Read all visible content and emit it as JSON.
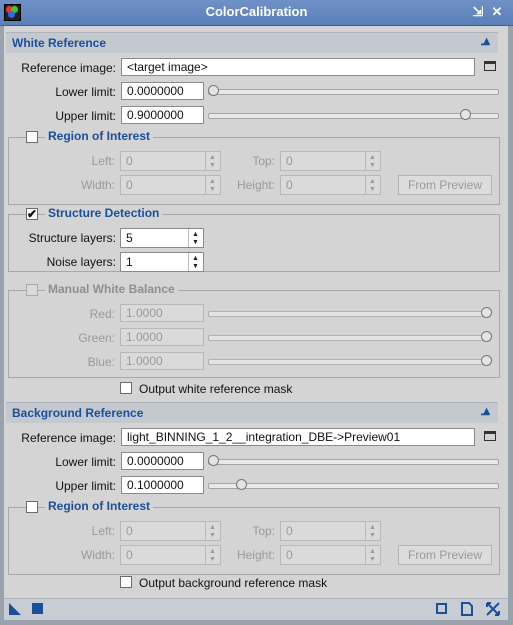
{
  "window": {
    "title": "ColorCalibration"
  },
  "white_reference": {
    "section_title": "White Reference",
    "reference_image_label": "Reference image:",
    "reference_image_value": "<target image>",
    "lower_limit_label": "Lower limit:",
    "lower_limit_value": "0.0000000",
    "lower_limit_fraction": 0.0,
    "upper_limit_label": "Upper limit:",
    "upper_limit_value": "0.9000000",
    "upper_limit_fraction": 0.9,
    "roi": {
      "title": "Region of Interest",
      "left_label": "Left:",
      "left_value": "0",
      "top_label": "Top:",
      "top_value": "0",
      "width_label": "Width:",
      "width_value": "0",
      "height_label": "Height:",
      "height_value": "0",
      "from_preview_label": "From Preview"
    },
    "structure": {
      "title": "Structure Detection",
      "checked": true,
      "layers_label": "Structure layers:",
      "layers_value": "5",
      "noise_label": "Noise layers:",
      "noise_value": "1"
    },
    "manual": {
      "title": "Manual White Balance",
      "red_label": "Red:",
      "red_value": "1.0000",
      "green_label": "Green:",
      "green_value": "1.0000",
      "blue_label": "Blue:",
      "blue_value": "1.0000"
    },
    "output_mask_label": "Output white reference mask"
  },
  "background_reference": {
    "section_title": "Background Reference",
    "reference_image_label": "Reference image:",
    "reference_image_value": "light_BINNING_1_2__integration_DBE->Preview01",
    "lower_limit_label": "Lower limit:",
    "lower_limit_value": "0.0000000",
    "lower_limit_fraction": 0.0,
    "upper_limit_label": "Upper limit:",
    "upper_limit_value": "0.1000000",
    "upper_limit_fraction": 0.1,
    "roi": {
      "title": "Region of Interest",
      "left_label": "Left:",
      "left_value": "0",
      "top_label": "Top:",
      "top_value": "0",
      "width_label": "Width:",
      "width_value": "0",
      "height_label": "Height:",
      "height_value": "0",
      "from_preview_label": "From Preview"
    },
    "output_mask_label": "Output background reference mask"
  },
  "icons": {
    "title_pin": "pin-icon",
    "title_close": "close-icon",
    "new_instance": "new-instance-triangle-icon",
    "apply_global": "apply-global-square-icon",
    "preview": "preview-icon",
    "reset": "reset-icon",
    "edit_instance": "edit-instance-icon"
  },
  "colors": {
    "accent": "#1a4f9a",
    "titlebar": "#5f84bf",
    "panel": "#d4d4d4"
  }
}
